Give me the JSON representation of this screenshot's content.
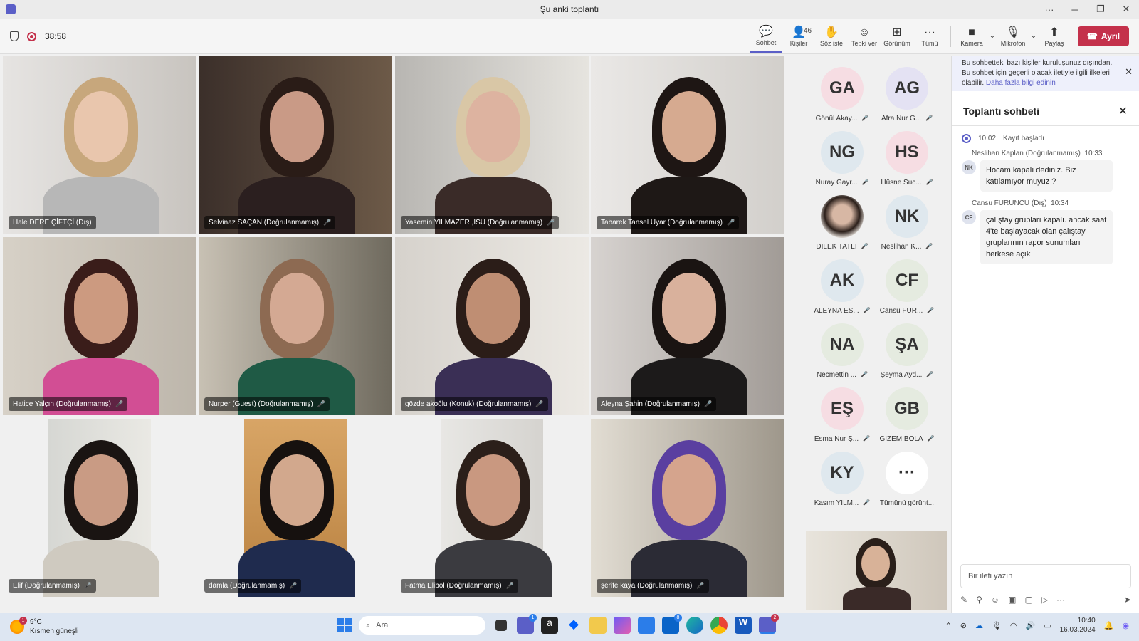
{
  "window": {
    "title": "Şu anki toplantı"
  },
  "toolbar": {
    "timer": "38:58",
    "chat": "Sohbet",
    "people": "Kişiler",
    "people_count": "46",
    "raise_hand": "Söz iste",
    "react": "Tepki ver",
    "view": "Görünüm",
    "more": "Tümü",
    "camera": "Kamera",
    "mic": "Mikrofon",
    "share": "Paylaş",
    "leave": "Ayrıl"
  },
  "tiles": [
    {
      "name": "Hale DERE ÇİFTÇİ (Dış)",
      "muted": false
    },
    {
      "name": "Selvinaz SAÇAN (Doğrulanmamış)",
      "muted": true
    },
    {
      "name": "Yasemin YILMAZER ,ISU (Doğrulanmamış)",
      "muted": true
    },
    {
      "name": "Tabarek Tansel Uyar (Doğrulanmamış)",
      "muted": true
    },
    {
      "name": "Hatice Yalçın (Doğrulanmamış)",
      "muted": true
    },
    {
      "name": "Nurper (Guest) (Doğrulanmamış)",
      "muted": true
    },
    {
      "name": "gözde akoğlu (Konuk) (Doğrulanmamış)",
      "muted": true
    },
    {
      "name": "Aleyna Şahin (Doğrulanmamış)",
      "muted": true
    },
    {
      "name": "Elif (Doğrulanmamış)",
      "muted": true
    },
    {
      "name": "damla (Doğrulanmamış)",
      "muted": true
    },
    {
      "name": "Fatma Elibol (Doğrulanmamış)",
      "muted": true
    },
    {
      "name": "şerife kaya (Doğrulanmamış)",
      "muted": true
    }
  ],
  "roster": [
    {
      "initials": "GA",
      "name": "Gönül Akay...",
      "color": "#f6dde3"
    },
    {
      "initials": "AG",
      "name": "Afra Nur G...",
      "color": "#e4e2f3"
    },
    {
      "initials": "NG",
      "name": "Nuray Gayr...",
      "color": "#dfe8ee"
    },
    {
      "initials": "HS",
      "name": "Hüsne Suc...",
      "color": "#f6dde3"
    },
    {
      "initials": "",
      "name": "DİLEK TATLI",
      "color": "#b89c8c"
    },
    {
      "initials": "NK",
      "name": "Neslihan K...",
      "color": "#dfe8ee"
    },
    {
      "initials": "AK",
      "name": "ALEYNA ES...",
      "color": "#dfe8ee"
    },
    {
      "initials": "CF",
      "name": "Cansu FUR...",
      "color": "#e5ebe0"
    },
    {
      "initials": "NA",
      "name": "Necmettin ...",
      "color": "#e5ebe0"
    },
    {
      "initials": "ŞA",
      "name": "Şeyma Ayd...",
      "color": "#e5ebe0"
    },
    {
      "initials": "EŞ",
      "name": "Esma Nur Ş...",
      "color": "#f6dde3"
    },
    {
      "initials": "GB",
      "name": "GİZEM BOLA",
      "color": "#e5ebe0"
    },
    {
      "initials": "KY",
      "name": "Kasım YILM...",
      "color": "#dfe8ee"
    },
    {
      "initials": "···",
      "name": "Tümünü görünt...",
      "color": "#ffffff"
    }
  ],
  "chat": {
    "banner": "Bu sohbetteki bazı kişiler kuruluşunuz dışından. Bu sohbet için geçerli olacak iletiyle ilgili ilkeleri olabilir.",
    "banner_link": "Daha fazla bilgi edinin",
    "title": "Toplantı sohbeti",
    "system_time": "10:02",
    "system_text": "Kayıt başladı",
    "messages": [
      {
        "author": "Neslihan Kaplan (Doğrulanmamış)",
        "time": "10:33",
        "initials": "NK",
        "text": "Hocam kapalı dediniz. Biz katılamıyor muyuz ?"
      },
      {
        "author": "Cansu FURUNCU (Dış)",
        "time": "10:34",
        "initials": "CF",
        "text": "çalıştay grupları kapalı. ancak saat 4'te başlayacak olan çalıştay gruplarının rapor sunumları herkese açık"
      }
    ],
    "compose_placeholder": "Bir ileti yazın"
  },
  "taskbar": {
    "temp": "9°C",
    "weather": "Kısmen güneşli",
    "weather_badge": "1",
    "search": "Ara",
    "teams_badge": "1",
    "mail_badge": "8",
    "teams2_badge": "2",
    "time": "10:40",
    "date": "16.03.2024"
  }
}
